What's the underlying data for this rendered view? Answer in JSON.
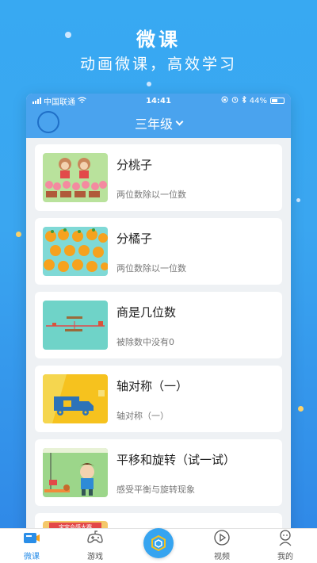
{
  "hero": {
    "title": "微课",
    "subtitle": "动画微课，高效学习"
  },
  "statusbar": {
    "carrier": "中国联通",
    "time": "14:41",
    "battery": "44%"
  },
  "appbar": {
    "grade": "三年级"
  },
  "lessons": [
    {
      "title": "分桃子",
      "subtitle": "两位数除以一位数"
    },
    {
      "title": "分橘子",
      "subtitle": "两位数除以一位数"
    },
    {
      "title": "商是几位数",
      "subtitle": "被除数中没有0"
    },
    {
      "title": "轴对称（一）",
      "subtitle": "轴对称（一）"
    },
    {
      "title": "平移和旋转（试一试）",
      "subtitle": "感受平衡与旋转现象"
    },
    {
      "thumb_text": "宝宝会感大赛"
    }
  ],
  "tabs": [
    {
      "label": "微课",
      "icon": "video-lesson-icon"
    },
    {
      "label": "游戏",
      "icon": "gamepad-icon"
    },
    {
      "label": "",
      "icon": "hexagon-icon"
    },
    {
      "label": "视频",
      "icon": "play-circle-icon"
    },
    {
      "label": "我的",
      "icon": "person-icon"
    }
  ],
  "colors": {
    "accent": "#2a8ee8",
    "appbar": "#4aa3ee",
    "background": "#38a9f2"
  }
}
